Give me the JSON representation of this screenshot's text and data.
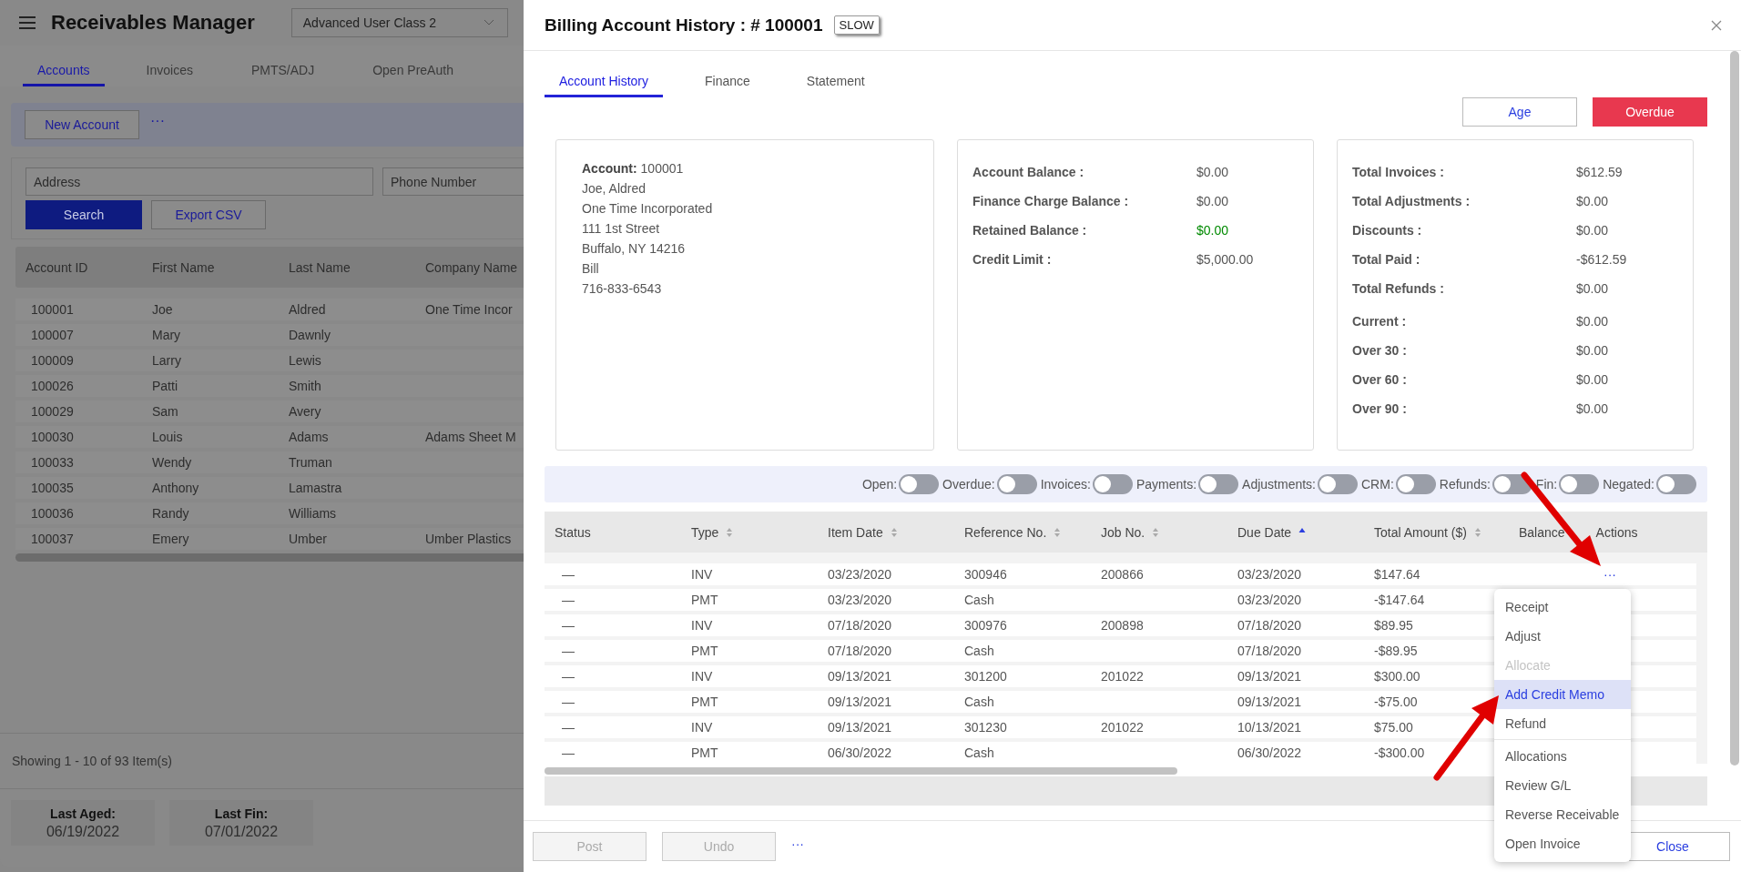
{
  "app": {
    "title": "Receivables Manager",
    "user_class": "Advanced User Class 2",
    "tabs": [
      {
        "label": "Accounts",
        "selected": true
      },
      {
        "label": "Invoices",
        "selected": false
      },
      {
        "label": "PMTS/ADJ",
        "selected": false
      },
      {
        "label": "Open PreAuth",
        "selected": false
      }
    ],
    "toolbar": {
      "new_button": "New Account",
      "more": "···"
    },
    "filters": {
      "address_placeholder": "Address",
      "phone_placeholder": "Phone Number",
      "search_button": "Search",
      "export_button": "Export CSV"
    },
    "table": {
      "columns": [
        "Account ID",
        "First Name",
        "Last Name",
        "Company Name"
      ],
      "rows": [
        [
          "100001",
          "Joe",
          "Aldred",
          "One Time Incor"
        ],
        [
          "100007",
          "Mary",
          "Dawnly",
          ""
        ],
        [
          "100009",
          "Larry",
          "Lewis",
          ""
        ],
        [
          "100026",
          "Patti",
          "Smith",
          ""
        ],
        [
          "100029",
          "Sam",
          "Avery",
          ""
        ],
        [
          "100030",
          "Louis",
          "Adams",
          "Adams Sheet M"
        ],
        [
          "100033",
          "Wendy",
          "Truman",
          ""
        ],
        [
          "100035",
          "Anthony",
          "Lamastra",
          ""
        ],
        [
          "100036",
          "Randy",
          "Williams",
          ""
        ],
        [
          "100037",
          "Emery",
          "Umber",
          "Umber Plastics"
        ]
      ]
    },
    "paging": "Showing 1 - 10 of 93 Item(s)",
    "dates": [
      {
        "label": "Last Aged:",
        "value": "06/19/2022"
      },
      {
        "label": "Last Fin:",
        "value": "07/01/2022"
      }
    ]
  },
  "modal": {
    "title": "Billing Account History : # 100001",
    "badge": "SLOW",
    "tabs": [
      {
        "label": "Account History",
        "selected": true
      },
      {
        "label": "Finance",
        "selected": false
      },
      {
        "label": "Statement",
        "selected": false
      }
    ],
    "buttons": [
      {
        "label": "Age",
        "kind": "outline"
      },
      {
        "label": "Overdue",
        "kind": "danger"
      }
    ],
    "account": {
      "label": "Account:",
      "number": "100001",
      "lines": [
        "Joe, Aldred",
        "One Time Incorporated",
        "111 1st Street",
        "Buffalo, NY 14216",
        "Bill",
        "716-833-6543"
      ]
    },
    "balances": [
      {
        "label": "Account Balance :",
        "value": "$0.00",
        "color": "#555555"
      },
      {
        "label": "Finance Charge Balance :",
        "value": "$0.00",
        "color": "#555555"
      },
      {
        "label": "Retained Balance :",
        "value": "$0.00",
        "color": "#008a00"
      },
      {
        "label": "Credit Limit :",
        "value": "$5,000.00",
        "color": "#555555"
      }
    ],
    "totals": [
      {
        "label": "Total Invoices :",
        "value": "$612.59"
      },
      {
        "label": "Total Adjustments :",
        "value": "$0.00"
      },
      {
        "label": "Discounts :",
        "value": "$0.00"
      },
      {
        "label": "Total Paid :",
        "value": "-$612.59"
      },
      {
        "label": "Total Refunds :",
        "value": "$0.00"
      }
    ],
    "aging": [
      {
        "label": "Current :",
        "value": "$0.00"
      },
      {
        "label": "Over 30 :",
        "value": "$0.00"
      },
      {
        "label": "Over 60 :",
        "value": "$0.00"
      },
      {
        "label": "Over 90 :",
        "value": "$0.00"
      }
    ],
    "filters": [
      {
        "label": "Open:",
        "on": false
      },
      {
        "label": "Overdue:",
        "on": false
      },
      {
        "label": "Invoices:",
        "on": false
      },
      {
        "label": "Payments:",
        "on": false
      },
      {
        "label": "Adjustments:",
        "on": false
      },
      {
        "label": "CRM:",
        "on": false
      },
      {
        "label": "Refunds:",
        "on": false
      },
      {
        "label": "Fin:",
        "on": false
      },
      {
        "label": "Negated:",
        "on": false
      }
    ],
    "columns": [
      {
        "label": "Status",
        "sortable": false
      },
      {
        "label": "Type",
        "sortable": true,
        "sorted": false
      },
      {
        "label": "Item Date",
        "sortable": true,
        "sorted": false
      },
      {
        "label": "Reference No.",
        "sortable": true,
        "sorted": false
      },
      {
        "label": "Job No.",
        "sortable": true,
        "sorted": false
      },
      {
        "label": "Due Date",
        "sortable": true,
        "sorted": true
      },
      {
        "label": "Total Amount ($)",
        "sortable": true,
        "sorted": false
      },
      {
        "label": "Balance",
        "sortable": false
      },
      {
        "label": "Actions",
        "sortable": false
      }
    ],
    "rows": [
      {
        "status": "—",
        "type": "INV",
        "item_date": "03/23/2020",
        "reference": "300946",
        "job": "200866",
        "due_date": "03/23/2020",
        "total": "$147.64",
        "actions": "···"
      },
      {
        "status": "—",
        "type": "PMT",
        "item_date": "03/23/2020",
        "reference": "Cash",
        "job": "",
        "due_date": "03/23/2020",
        "total": "-$147.64",
        "actions": ""
      },
      {
        "status": "—",
        "type": "INV",
        "item_date": "07/18/2020",
        "reference": "300976",
        "job": "200898",
        "due_date": "07/18/2020",
        "total": "$89.95",
        "actions": ""
      },
      {
        "status": "—",
        "type": "PMT",
        "item_date": "07/18/2020",
        "reference": "Cash",
        "job": "",
        "due_date": "07/18/2020",
        "total": "-$89.95",
        "actions": ""
      },
      {
        "status": "—",
        "type": "INV",
        "item_date": "09/13/2021",
        "reference": "301200",
        "job": "201022",
        "due_date": "09/13/2021",
        "total": "$300.00",
        "actions": ""
      },
      {
        "status": "—",
        "type": "PMT",
        "item_date": "09/13/2021",
        "reference": "Cash",
        "job": "",
        "due_date": "09/13/2021",
        "total": "-$75.00",
        "actions": ""
      },
      {
        "status": "—",
        "type": "INV",
        "item_date": "09/13/2021",
        "reference": "301230",
        "job": "201022",
        "due_date": "10/13/2021",
        "total": "$75.00",
        "actions": ""
      },
      {
        "status": "—",
        "type": "PMT",
        "item_date": "06/30/2022",
        "reference": "Cash",
        "job": "",
        "due_date": "06/30/2022",
        "total": "-$300.00",
        "actions": ""
      }
    ],
    "menu": [
      [
        {
          "label": "Receipt",
          "disabled": false,
          "selected": false
        },
        {
          "label": "Adjust",
          "disabled": false,
          "selected": false
        },
        {
          "label": "Allocate",
          "disabled": true,
          "selected": false
        },
        {
          "label": "Add Credit Memo",
          "disabled": false,
          "selected": true
        },
        {
          "label": "Refund",
          "disabled": false,
          "selected": false
        }
      ],
      [
        {
          "label": "Allocations",
          "disabled": false,
          "selected": false
        },
        {
          "label": "Review G/L",
          "disabled": false,
          "selected": false
        },
        {
          "label": "Reverse Receivable",
          "disabled": false,
          "selected": false
        },
        {
          "label": "Open Invoice",
          "disabled": false,
          "selected": false
        }
      ]
    ],
    "footer": [
      {
        "label": "Post",
        "disabled": true
      },
      {
        "label": "Undo",
        "disabled": true
      }
    ],
    "footer_more": "···",
    "close_button": "Close"
  }
}
